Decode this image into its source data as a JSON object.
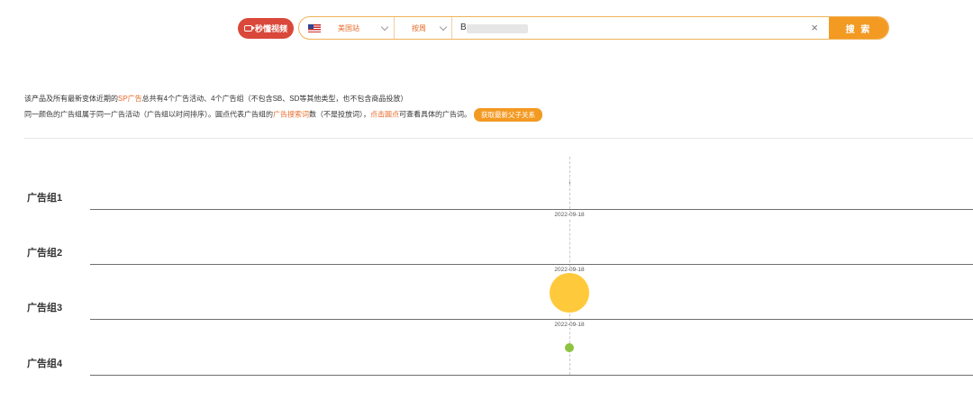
{
  "header": {
    "video_button_label": "秒懂视频",
    "site_label": "美国站",
    "mode_label": "按周",
    "query_value": "B",
    "clear_icon": "×",
    "search_label": "搜 索"
  },
  "info": {
    "line1_a": "该产品及所有最新变体近期的",
    "line1_hl": "SP广告",
    "line1_b": "总共有4个广告活动、4个广告组（不包含SB、SD等其他类型，也不包含商品投放）",
    "line2_a": "同一颜色的广告组属于同一广告活动（广告组以时间排序）。圆点代表广告组的",
    "line2_hl1": "广告搜索词",
    "line2_b": "数（不是投放词），",
    "line2_hl2": "点击圆点",
    "line2_c": "可查看具体的广告词。",
    "refresh_button": "获取最新父子关系"
  },
  "chart_data": {
    "type": "scatter",
    "rows": [
      "广告组1",
      "广告组2",
      "广告组3",
      "广告组4"
    ],
    "date_labels": [
      "2022-09-18",
      "2022-09-18",
      "2022-09-18"
    ],
    "points": [
      {
        "row": "广告组3",
        "date": "2022-09-18",
        "color": "#ffc93c",
        "size": "large"
      },
      {
        "row": "广告组4",
        "date": "2022-09-18",
        "color": "#8dc43f",
        "size": "small"
      }
    ]
  },
  "colors": {
    "accent": "#f39a23",
    "video_button": "#d9483b",
    "highlight_text": "#e86b2a"
  }
}
